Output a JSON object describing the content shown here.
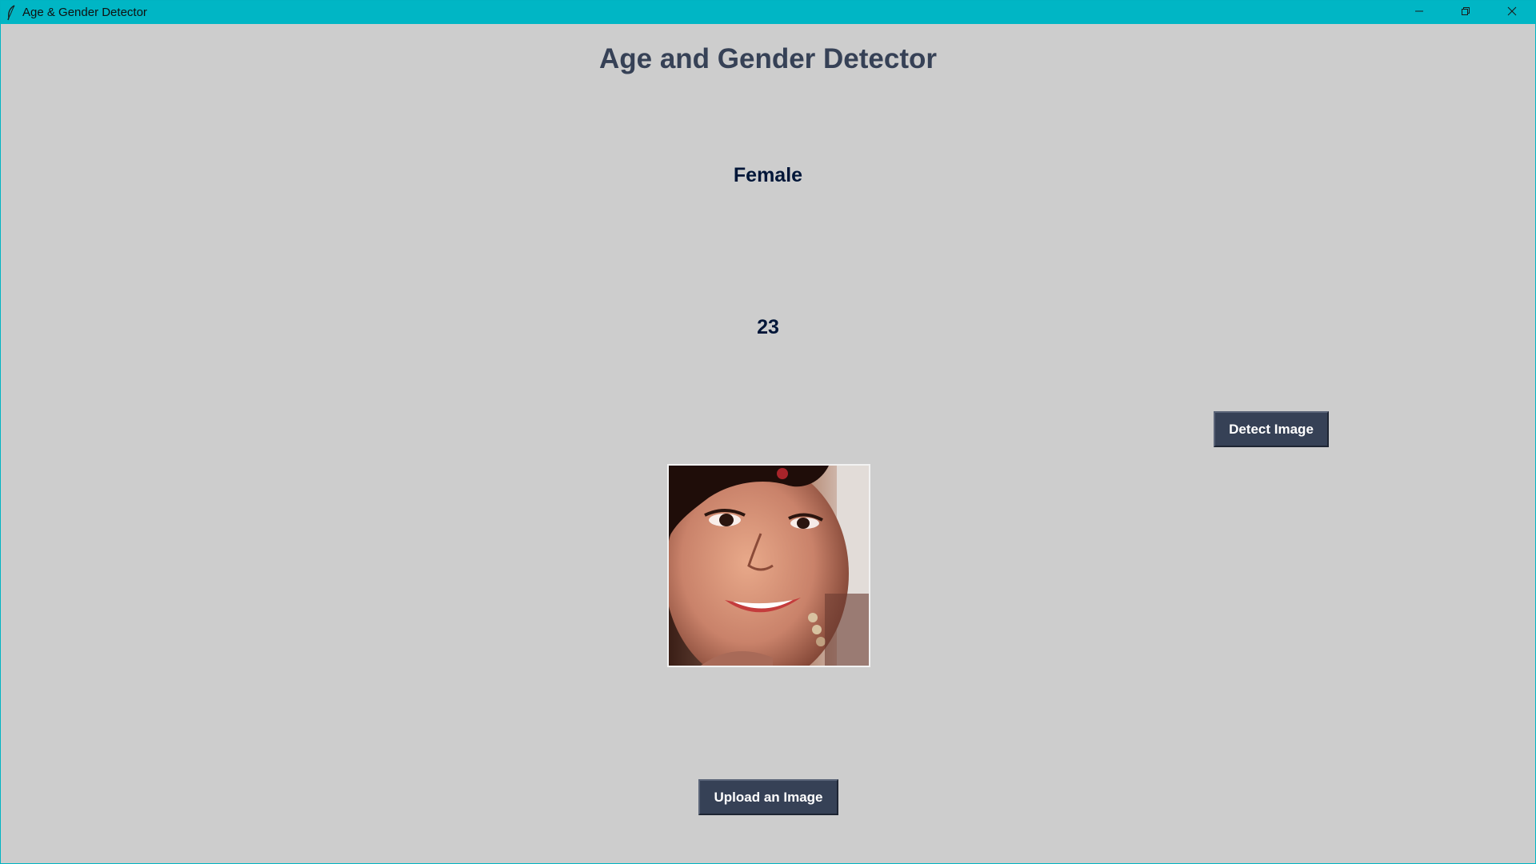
{
  "window": {
    "title": "Age & Gender Detector",
    "icon": "feather-icon",
    "controls": {
      "minimize_icon": "minimize-icon",
      "maximize_icon": "restore-icon",
      "close_icon": "close-icon"
    }
  },
  "app": {
    "heading": "Age and Gender Detector",
    "gender_result": "Female",
    "age_result": "23",
    "detect_button": "Detect Image",
    "upload_button": "Upload an Image",
    "uploaded_image": "face-photo"
  },
  "colors": {
    "titlebar": "#00b6c5",
    "background": "#cdcdcd",
    "heading": "#364156",
    "result_text": "#011638",
    "button_bg": "#364156",
    "button_text": "#ffffff"
  }
}
